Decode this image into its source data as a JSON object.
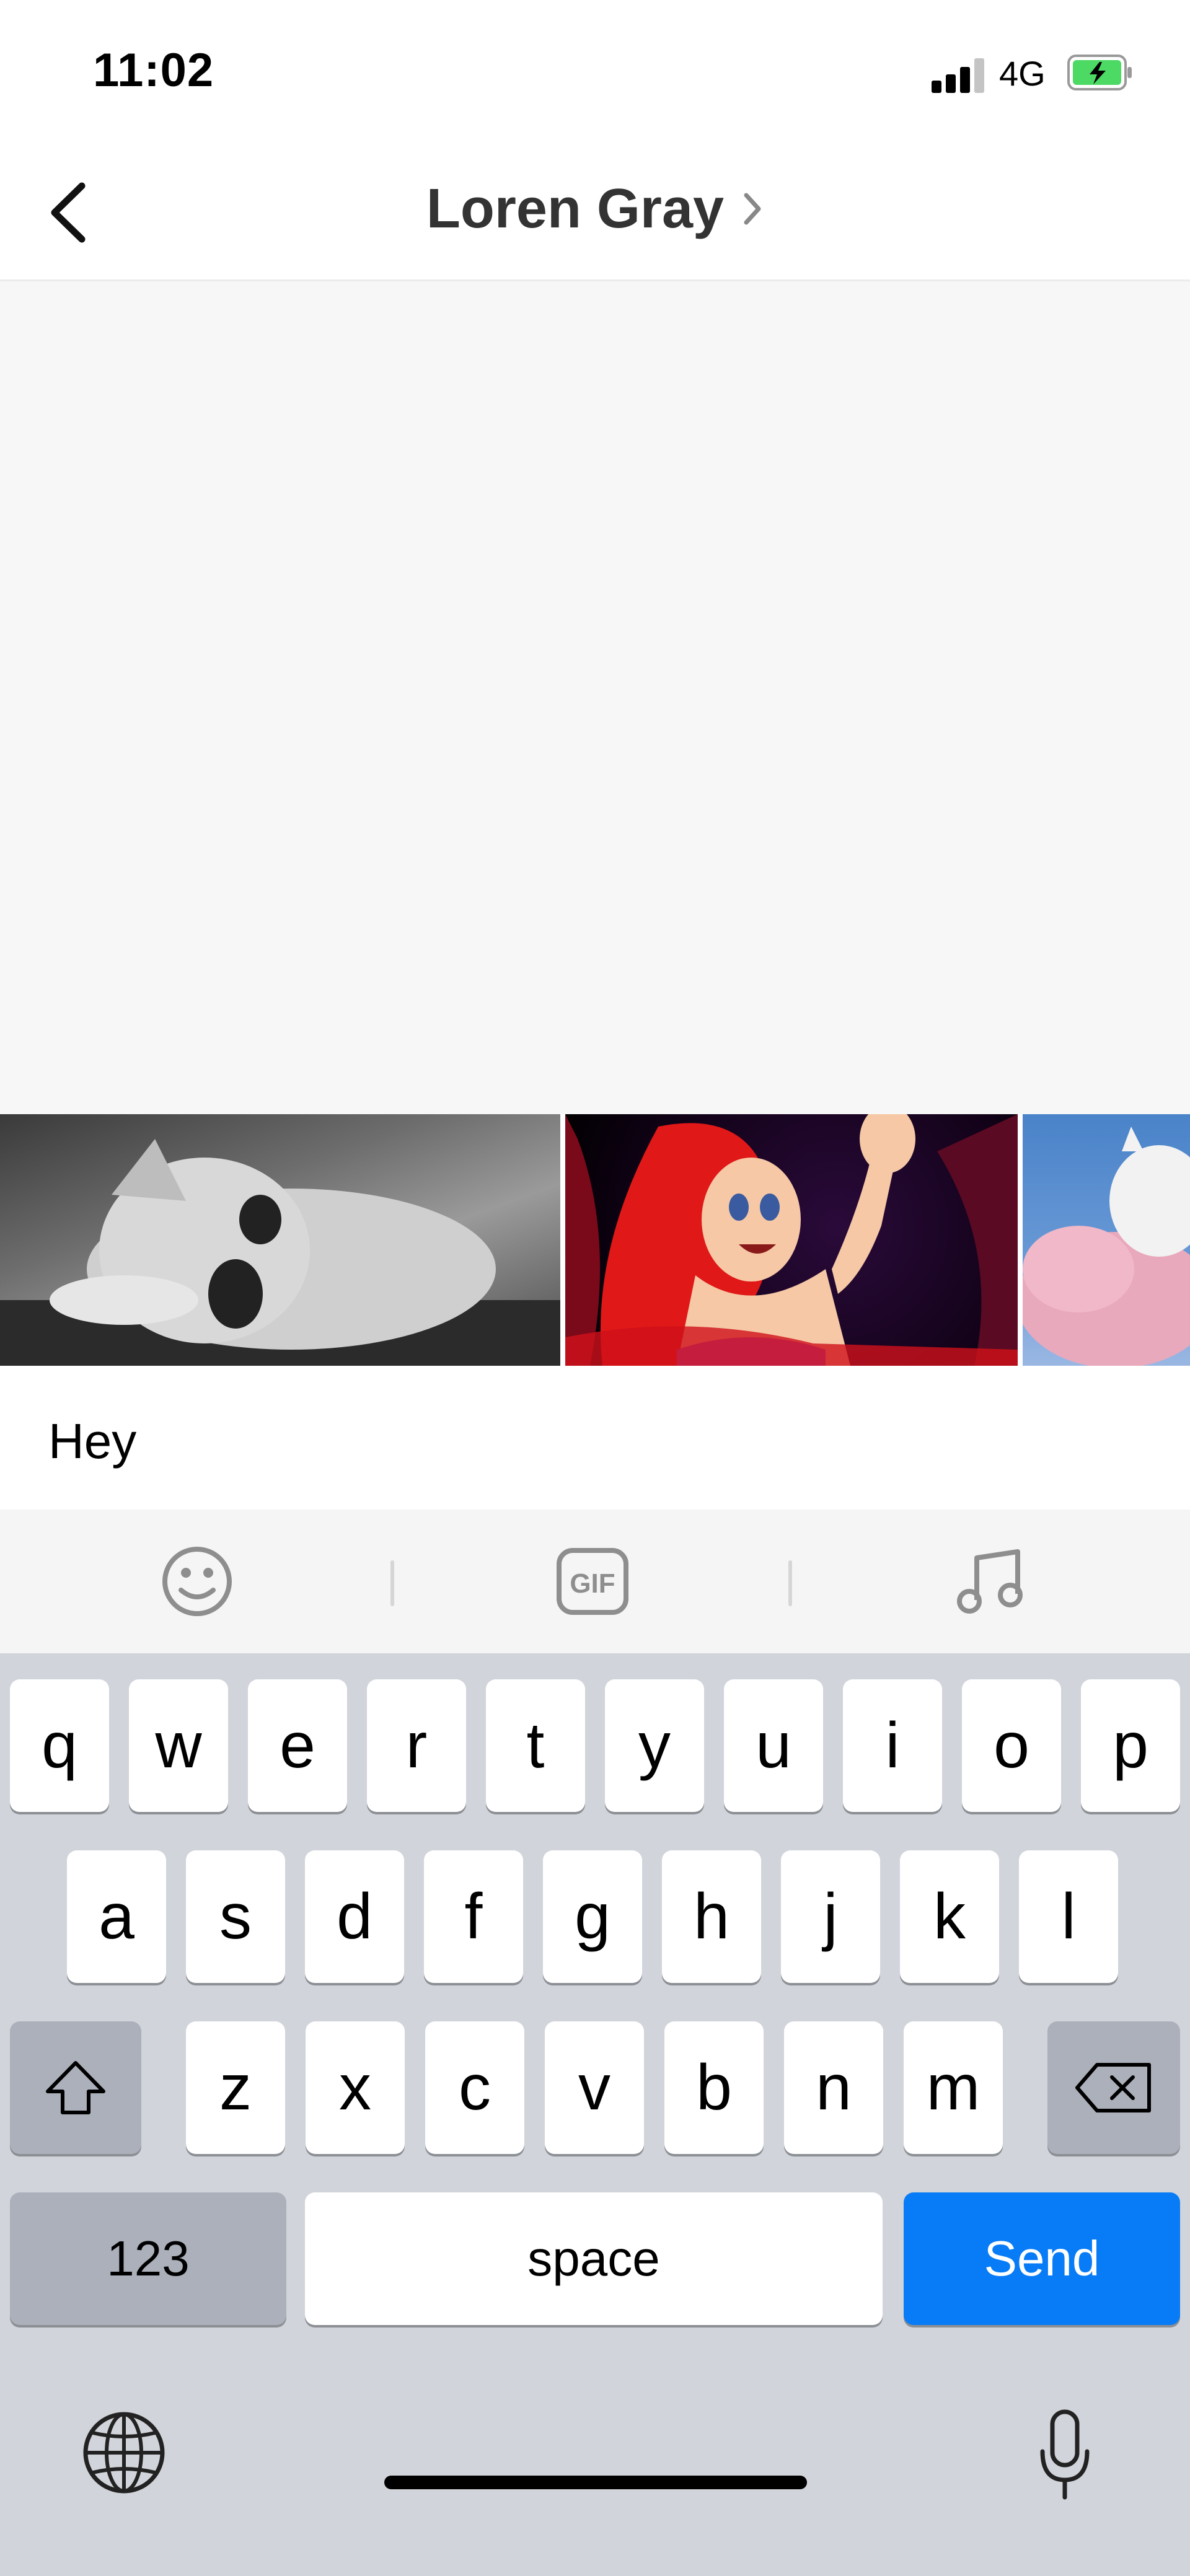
{
  "status": {
    "time": "11:02",
    "network": "4G"
  },
  "nav": {
    "title": "Loren Gray"
  },
  "gifs": [
    {
      "name": "cat"
    },
    {
      "name": "ariel"
    },
    {
      "name": "moomin"
    }
  ],
  "message": {
    "text": "Hey"
  },
  "toolbar": {
    "icons": [
      "emoji-icon",
      "gif-icon",
      "music-icon"
    ],
    "gif_label": "GIF"
  },
  "keyboard": {
    "row1": [
      "q",
      "w",
      "e",
      "r",
      "t",
      "y",
      "u",
      "i",
      "o",
      "p"
    ],
    "row2": [
      "a",
      "s",
      "d",
      "f",
      "g",
      "h",
      "j",
      "k",
      "l"
    ],
    "row3": [
      "z",
      "x",
      "c",
      "v",
      "b",
      "n",
      "m"
    ],
    "numbers_label": "123",
    "space_label": "space",
    "send_label": "Send"
  },
  "colors": {
    "send": "#087cf6",
    "battery": "#4cd964"
  }
}
